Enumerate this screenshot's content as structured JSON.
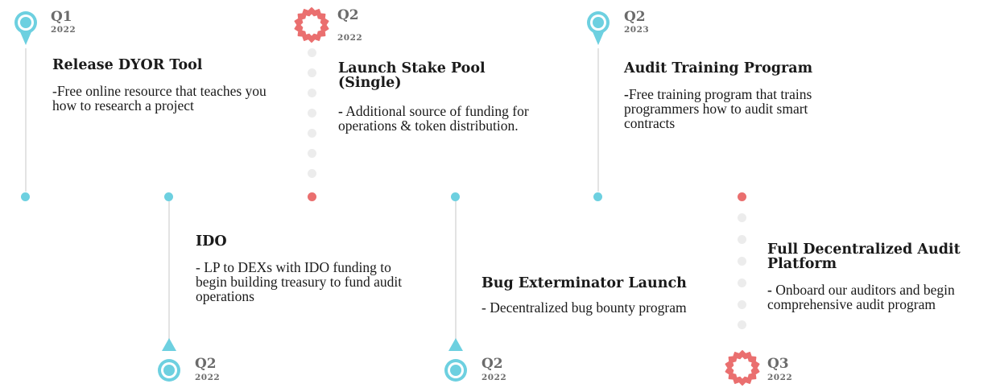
{
  "colors": {
    "teal": "#6dd0e0",
    "coral": "#ea6f6f",
    "gray_dot": "#ececec",
    "line": "#e3e3e3"
  },
  "milestones": [
    {
      "quarter": "Q1",
      "year": "2022",
      "marker": "pin-icon",
      "title": "Release DYOR Tool",
      "description": "-Free online resource that teaches you how to research a project"
    },
    {
      "quarter": "Q2",
      "year": "2022",
      "marker": "pin-icon",
      "title": "IDO",
      "description": "- LP to DEXs with IDO funding to begin building treasury to fund audit operations"
    },
    {
      "quarter": "Q2",
      "year": "2022",
      "marker": "badge-icon",
      "title": "Launch Stake Pool (Single)",
      "description_bold": "-",
      "description": " Additional source of funding for operations & token distribution."
    },
    {
      "quarter": "Q2",
      "year": "2022",
      "marker": "pin-icon",
      "title": "Bug Exterminator Launch",
      "description": "- Decentralized bug bounty program"
    },
    {
      "quarter": "Q2",
      "year": "2023",
      "marker": "pin-icon",
      "title": "Audit Training Program",
      "description_bold": "-",
      "description": "Free training program that trains programmers how to audit smart contracts"
    },
    {
      "quarter": "Q3",
      "year": "2022",
      "marker": "badge-icon",
      "title": "Full Decentralized Audit Platform",
      "description_bold": "-",
      "description": " Onboard our auditors and begin comprehensive audit program"
    }
  ]
}
